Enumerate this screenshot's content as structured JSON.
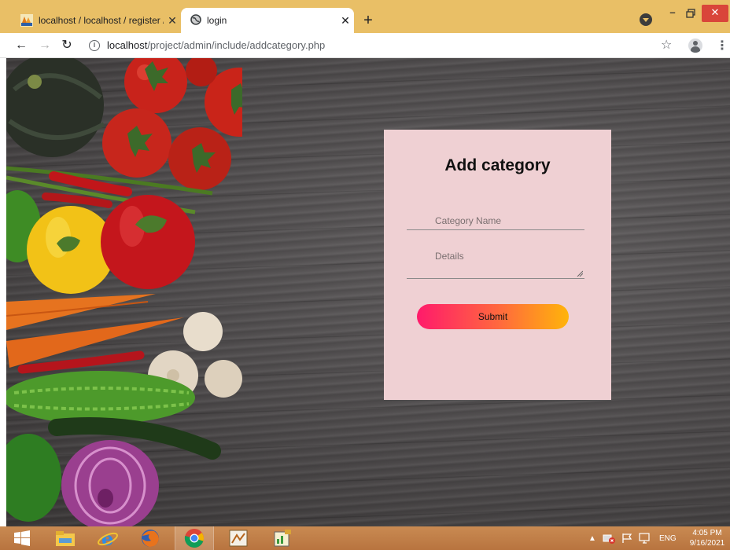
{
  "browser": {
    "tabs": [
      {
        "title": "localhost / localhost / register / s",
        "icon": "phpmyadmin-icon",
        "active": false
      },
      {
        "title": "login",
        "icon": "globe-icon",
        "active": true
      }
    ],
    "new_tab_symbol": "+",
    "address": {
      "host": "localhost",
      "path": "/project/admin/include/addcategory.php"
    }
  },
  "form": {
    "title": "Add category",
    "category_placeholder": "Category Name",
    "details_placeholder": "Details",
    "submit_label": "Submit"
  },
  "taskbar": {
    "apps": [
      "windows-start-icon",
      "file-explorer-icon",
      "internet-explorer-icon",
      "firefox-icon",
      "chrome-icon",
      "xampp-icon",
      "app-icon"
    ],
    "language": "ENG",
    "time": "4:05 PM",
    "date": "9/16/2021"
  },
  "colors": {
    "tab_strip": "#e9bf66",
    "card": "#efd0d3",
    "button_start": "#ff1a6b",
    "button_end": "#ffb40a",
    "taskbar": "#c98a52",
    "close_button": "#d9453a"
  }
}
